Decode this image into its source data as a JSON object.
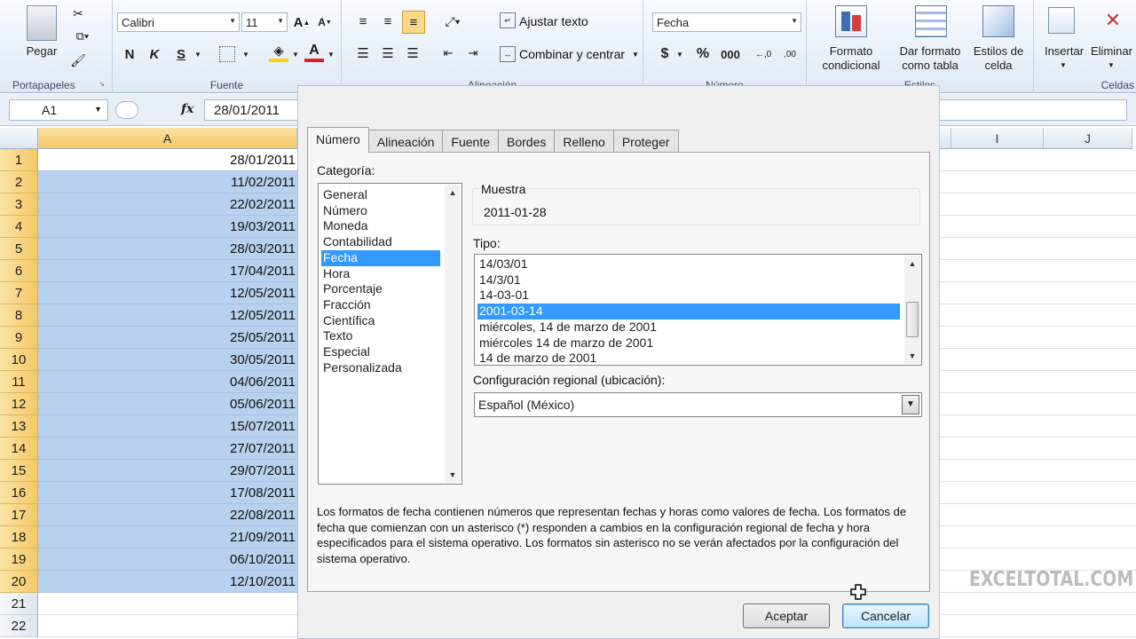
{
  "ribbon": {
    "clipboard": {
      "paste": "Pegar",
      "group": "Portapapeles"
    },
    "font": {
      "name": "Calibri",
      "size": "11",
      "bold": "N",
      "italic": "K",
      "underline": "S",
      "group": "Fuente"
    },
    "alignment": {
      "wrap": "Ajustar texto",
      "merge": "Combinar y centrar",
      "group": "Alineación"
    },
    "number": {
      "format": "Fecha",
      "currency": "$",
      "percent": "%",
      "thousands": "000",
      "inc_decimal": "←,0",
      "dec_decimal": ",00",
      "group": "Número"
    },
    "styles": {
      "conditional": "Formato condicional",
      "as_table": "Dar formato como tabla",
      "cell_styles": "Estilos de celda",
      "group": "Estilos"
    },
    "cells": {
      "insert": "Insertar",
      "delete": "Eliminar",
      "group": "Celdas"
    }
  },
  "formula_bar": {
    "name_box": "A1",
    "fx": "fx",
    "value": "28/01/2011"
  },
  "grid": {
    "columns": [
      "A",
      "I",
      "J"
    ],
    "rows": [
      {
        "n": "1",
        "v": "28/01/2011"
      },
      {
        "n": "2",
        "v": "11/02/2011"
      },
      {
        "n": "3",
        "v": "22/02/2011"
      },
      {
        "n": "4",
        "v": "19/03/2011"
      },
      {
        "n": "5",
        "v": "28/03/2011"
      },
      {
        "n": "6",
        "v": "17/04/2011"
      },
      {
        "n": "7",
        "v": "12/05/2011"
      },
      {
        "n": "8",
        "v": "12/05/2011"
      },
      {
        "n": "9",
        "v": "25/05/2011"
      },
      {
        "n": "10",
        "v": "30/05/2011"
      },
      {
        "n": "11",
        "v": "04/06/2011"
      },
      {
        "n": "12",
        "v": "05/06/2011"
      },
      {
        "n": "13",
        "v": "15/07/2011"
      },
      {
        "n": "14",
        "v": "27/07/2011"
      },
      {
        "n": "15",
        "v": "29/07/2011"
      },
      {
        "n": "16",
        "v": "17/08/2011"
      },
      {
        "n": "17",
        "v": "22/08/2011"
      },
      {
        "n": "18",
        "v": "21/09/2011"
      },
      {
        "n": "19",
        "v": "06/10/2011"
      },
      {
        "n": "20",
        "v": "12/10/2011"
      },
      {
        "n": "21",
        "v": ""
      },
      {
        "n": "22",
        "v": ""
      }
    ]
  },
  "dialog": {
    "tabs": [
      "Número",
      "Alineación",
      "Fuente",
      "Bordes",
      "Relleno",
      "Proteger"
    ],
    "category_label": "Categoría:",
    "categories": [
      "General",
      "Número",
      "Moneda",
      "Contabilidad",
      "Fecha",
      "Hora",
      "Porcentaje",
      "Fracción",
      "Científica",
      "Texto",
      "Especial",
      "Personalizada"
    ],
    "selected_category": "Fecha",
    "sample_label": "Muestra",
    "sample_value": "2011-01-28",
    "type_label": "Tipo:",
    "types": [
      "14/03/01",
      "14/3/01",
      "14-03-01",
      "2001-03-14",
      "miércoles, 14 de marzo de 2001",
      "miércoles 14 de marzo de 2001",
      "14 de marzo de 2001"
    ],
    "selected_type": "2001-03-14",
    "locale_label": "Configuración regional (ubicación):",
    "locale_value": "Español (México)",
    "description": "Los formatos de fecha contienen números que representan fechas y horas como valores de fecha. Los formatos de fecha que comienzan con un asterisco (*) responden a cambios en la configuración regional de fecha y hora especificados para el sistema operativo. Los formatos sin asterisco no se verán afectados por la configuración del sistema operativo.",
    "ok": "Aceptar",
    "cancel": "Cancelar"
  },
  "watermark": "EXCELTOTAL.COM"
}
